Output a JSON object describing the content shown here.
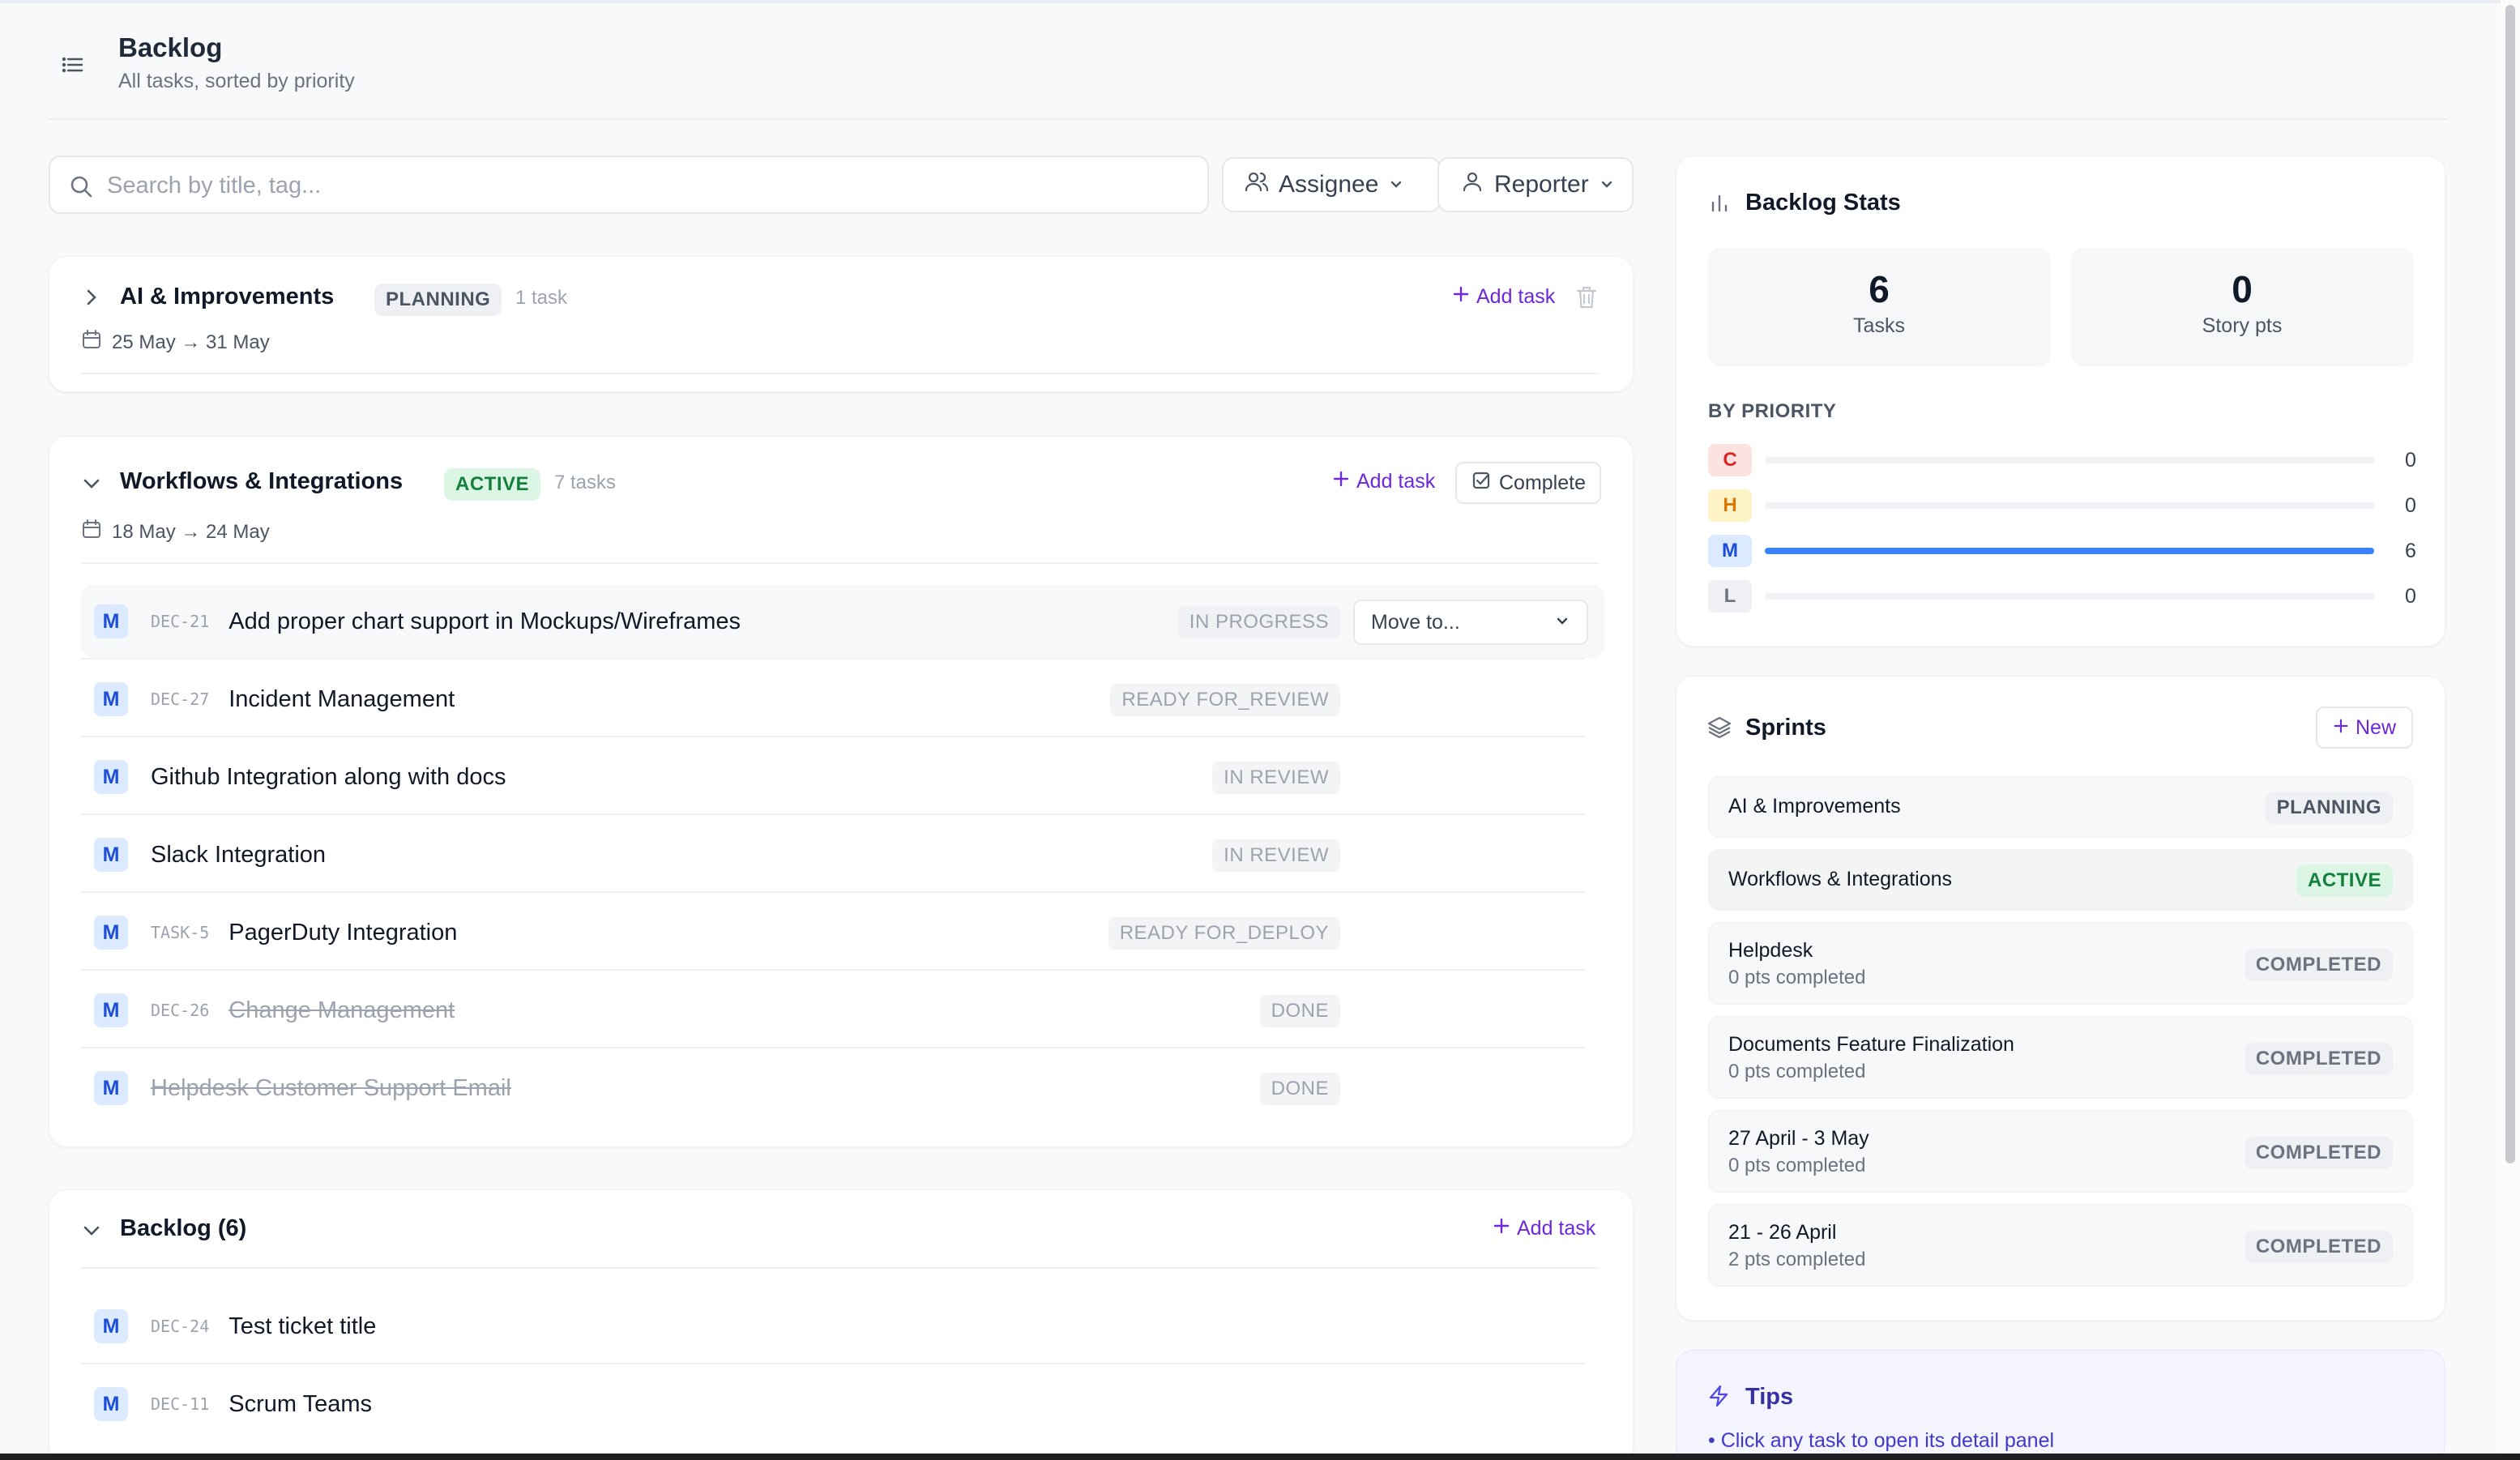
{
  "header": {
    "title": "Backlog",
    "subtitle": "All tasks, sorted by priority"
  },
  "toolbar": {
    "search_placeholder": "Search by title, tag...",
    "assignee_label": "Assignee",
    "reporter_label": "Reporter"
  },
  "sprints": [
    {
      "name": "AI & Improvements",
      "status": "PLANNING",
      "count": "1 task",
      "dates": "25 May → 31 May",
      "add_label": "Add task"
    },
    {
      "name": "Workflows & Integrations",
      "status": "ACTIVE",
      "count": "7 tasks",
      "dates": "18 May → 24 May",
      "add_label": "Add task",
      "complete_label": "Complete",
      "move_label": "Move to...",
      "tasks": [
        {
          "priority": "M",
          "key": "DEC-21",
          "title": "Add proper chart support in Mockups/Wireframes",
          "status": "IN PROGRESS"
        },
        {
          "priority": "M",
          "key": "DEC-27",
          "title": "Incident Management",
          "status": "READY FOR_REVIEW"
        },
        {
          "priority": "M",
          "key": "",
          "title": "Github Integration along with docs",
          "status": "IN REVIEW"
        },
        {
          "priority": "M",
          "key": "",
          "title": "Slack Integration",
          "status": "IN REVIEW"
        },
        {
          "priority": "M",
          "key": "TASK-5",
          "title": "PagerDuty Integration",
          "status": "READY FOR_DEPLOY"
        },
        {
          "priority": "M",
          "key": "DEC-26",
          "title": "Change Management",
          "status": "DONE"
        },
        {
          "priority": "M",
          "key": "",
          "title": "Helpdesk Customer Support Email",
          "status": "DONE"
        }
      ]
    }
  ],
  "backlog": {
    "title": "Backlog (6)",
    "add_label": "Add task",
    "tasks": [
      {
        "priority": "M",
        "key": "DEC-24",
        "title": "Test ticket title"
      },
      {
        "priority": "M",
        "key": "DEC-11",
        "title": "Scrum Teams"
      }
    ]
  },
  "stats": {
    "title": "Backlog Stats",
    "tasks_value": "6",
    "tasks_label": "Tasks",
    "points_value": "0",
    "points_label": "Story pts",
    "by_priority_label": "BY PRIORITY",
    "priorities": [
      {
        "label": "C",
        "value": "0",
        "fraction": 0,
        "bg": "#fde2e2",
        "fg": "#dc2626"
      },
      {
        "label": "H",
        "value": "0",
        "fraction": 0,
        "bg": "#fef3c7",
        "fg": "#d97706"
      },
      {
        "label": "M",
        "value": "6",
        "fraction": 1,
        "bg": "#dbeafe",
        "fg": "#1d4ed8"
      },
      {
        "label": "L",
        "value": "0",
        "fraction": 0,
        "bg": "#eef0f3",
        "fg": "#6b7280"
      }
    ]
  },
  "sprints_panel": {
    "title": "Sprints",
    "new_label": "New",
    "items": [
      {
        "name": "AI & Improvements",
        "sub": "",
        "status": "PLANNING"
      },
      {
        "name": "Workflows & Integrations",
        "sub": "",
        "status": "ACTIVE"
      },
      {
        "name": "Helpdesk",
        "sub": "0 pts completed",
        "status": "COMPLETED"
      },
      {
        "name": "Documents Feature Finalization",
        "sub": "0 pts completed",
        "status": "COMPLETED"
      },
      {
        "name": "27 April - 3 May",
        "sub": "0 pts completed",
        "status": "COMPLETED"
      },
      {
        "name": "21 - 26 April",
        "sub": "2 pts completed",
        "status": "COMPLETED"
      }
    ]
  },
  "tips": {
    "title": "Tips",
    "items": [
      "• Click any task to open its detail panel"
    ]
  },
  "colors": {
    "accent": "#6d28d9",
    "bar": "#3b82f6",
    "active_bg": "#dcf6e6",
    "active_fg": "#15803d"
  }
}
